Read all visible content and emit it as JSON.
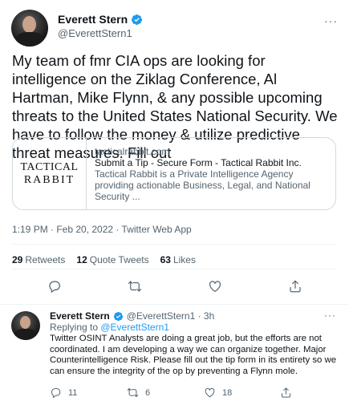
{
  "main_tweet": {
    "author": {
      "display_name": "Everett Stern",
      "handle": "@EverettStern1",
      "verified": true
    },
    "more_label": "···",
    "text": "My team of fmr CIA ops are looking for intelligence on the Ziklag Conference, Al Hartman, Mike Flynn, & any possible upcoming threats to the United States National Security. We have to follow the money & utilize predictive threat measures. Fill out",
    "card": {
      "logo_line1": "TACTICAL",
      "logo_line2": "RABBIT",
      "domain": "tacticalrabbit.com",
      "title": "Submit a Tip - Secure Form - Tactical Rabbit Inc.",
      "description": "Tactical Rabbit is a Private Intelligence Agency providing actionable Business, Legal, and National Security ..."
    },
    "timestamp": "1:19 PM · Feb 20, 2022 · Twitter Web App",
    "stats": {
      "retweets_count": "29",
      "retweets_label": "Retweets",
      "quotes_count": "12",
      "quotes_label": "Quote Tweets",
      "likes_count": "63",
      "likes_label": "Likes"
    },
    "actions": [
      "reply-icon",
      "retweet-icon",
      "like-icon",
      "share-icon"
    ]
  },
  "reply_tweet": {
    "author": {
      "display_name": "Everett Stern",
      "handle_time": "@EverettStern1 · 3h",
      "verified": true
    },
    "more_label": "···",
    "replying_prefix": "Replying to ",
    "replying_handle": "@EverettStern1",
    "text": "Twitter OSINT Analysts are doing a great job, but the efforts are not coordinated. I am developing a way we can organize together. Major Counterintelligence Risk. Please fill out the tip form in its entirety so we can ensure the integrity of the op by preventing a Flynn mole.",
    "counts": {
      "replies": "11",
      "retweets": "6",
      "likes": "18"
    }
  },
  "colors": {
    "verified": "#1d9bf0",
    "link": "#1d9bf0",
    "secondary_text": "#536471",
    "primary_text": "#0f1419",
    "border": "#cfd9de"
  }
}
